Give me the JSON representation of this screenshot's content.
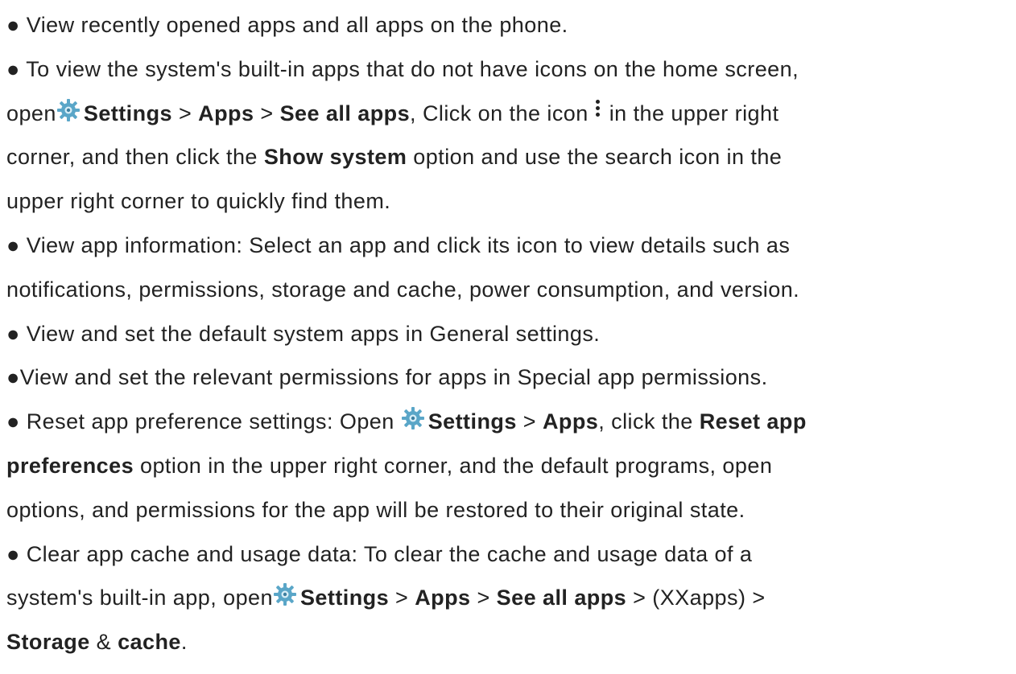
{
  "bullet": "●",
  "icons": {
    "settings": "settings-gear-icon",
    "more": "more-vertical-icon",
    "settings_color": "#5aa6c8"
  },
  "line1": {
    "text": " View recently opened apps and all apps on the phone."
  },
  "line2": {
    "text": " To view the system's built-in apps that do not have icons on the home screen,"
  },
  "line3": {
    "t1": "open",
    "b1": "Settings",
    "t2": " > ",
    "b2": "Apps",
    "t3": " > ",
    "b3": "See all apps",
    "t4": ", Click on the icon",
    "t5": "in the upper right"
  },
  "line4": {
    "t1": "corner, and then click the ",
    "b1": "Show system",
    "t2": " option and use the search icon in the"
  },
  "line5": {
    "text": "upper right corner to quickly find them."
  },
  "line6": {
    "text": " View app information: Select an app and click its icon to view details such as"
  },
  "line7": {
    "text": "notifications, permissions, storage and cache, power consumption, and version."
  },
  "line8": {
    "text": " View and set the default system apps in General settings."
  },
  "line9": {
    "text": "View and set the relevant permissions for apps in Special app permissions."
  },
  "line10": {
    "t1": " Reset app preference settings: Open ",
    "b1": "Settings",
    "t2": " > ",
    "b2": "Apps",
    "t3": ", click the ",
    "b3": "Reset app"
  },
  "line11": {
    "b1": "preferences",
    "t1": " option in the upper right corner, and the default programs, open"
  },
  "line12": {
    "text": "options, and permissions for the app will be restored to their original state."
  },
  "line13": {
    "text": " Clear app cache and usage data: To clear the cache and usage data of a"
  },
  "line14": {
    "t1": "system's built-in app, open",
    "b1": "Settings",
    "t2": " > ",
    "b2": "Apps",
    "t3": " > ",
    "b3": "See all apps",
    "t4": " > (XXapps) >"
  },
  "line15": {
    "b1": "Storage",
    "t1": " & ",
    "b2": "cache",
    "t2": "."
  }
}
